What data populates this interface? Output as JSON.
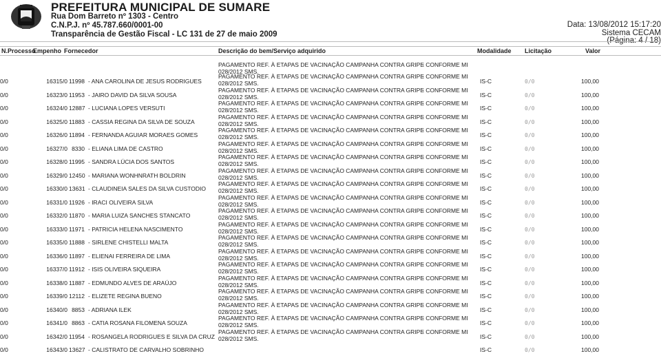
{
  "header": {
    "org_name": "PREFEITURA MUNICIPAL DE SUMARE",
    "address": "Rua Dom Barreto nº 1303 - Centro",
    "cnpj": "C.N.P.J. nº 45.787.660/0001-00",
    "subtitle": "Transparência de Gestão Fiscal - LC 131 de 27 de maio 2009",
    "date": "Data: 13/08/2012 15:17:20",
    "system": "Sistema CECAM",
    "page": "(Página: 4 / 18)",
    "logo_icon": "municipal-coat-of-arms"
  },
  "columns": {
    "processo": "N.Processo",
    "empenho": "Empenho",
    "fornecedor": "Fornecedor",
    "descricao": "Descrição do bem/Serviço adquirido",
    "modalidade": "Modalidade",
    "licitacao": "Licitação",
    "valor": "Valor"
  },
  "carryover": {
    "desc_line1": "PAGAMENTO REF. À ETAPAS DE VACINAÇÃO CAMPANHA CONTRA GRIPE",
    "desc_line2": "028/2012 SMS.",
    "conforme": "- CONFORME MI"
  },
  "rows": [
    {
      "processo": "0/0",
      "n": "16315/0",
      "empenho": "11998",
      "fornecedor": "- ANA CAROLINA DE JESUS RODRIGUES",
      "desc1": "PAGAMENTO REF. À ETAPAS DE VACINAÇÃO CAMPANHA CONTRA GRIPE",
      "desc2": "028/2012 SMS.",
      "conforme": "- CONFORME MI",
      "modalidade": "IS-C",
      "licitacao": "0/0",
      "valor": "100,00"
    },
    {
      "processo": "0/0",
      "n": "16323/0",
      "empenho": "11953",
      "fornecedor": "- JAIRO DAVID DA SILVA SOUSA",
      "desc1": "PAGAMENTO REF. À ETAPAS DE VACINAÇÃO CAMPANHA CONTRA GRIPE",
      "desc2": "028/2012 SMS.",
      "conforme": "- CONFORME MI",
      "modalidade": "IS-C",
      "licitacao": "0/0",
      "valor": "100,00"
    },
    {
      "processo": "0/0",
      "n": "16324/0",
      "empenho": "12887",
      "fornecedor": "- LUCIANA LOPES VERSUTI",
      "desc1": "PAGAMENTO REF. À ETAPAS DE VACINAÇÃO CAMPANHA CONTRA GRIPE",
      "desc2": "028/2012 SMS.",
      "conforme": "- CONFORME MI",
      "modalidade": "IS-C",
      "licitacao": "0/0",
      "valor": "100,00"
    },
    {
      "processo": "0/0",
      "n": "16325/0",
      "empenho": "11883",
      "fornecedor": "- CASSIA REGINA DA SILVA DE SOUZA",
      "desc1": "PAGAMENTO REF. À ETAPAS DE VACINAÇÃO CAMPANHA CONTRA GRIPE",
      "desc2": "028/2012 SMS.",
      "conforme": "- CONFORME MI",
      "modalidade": "IS-C",
      "licitacao": "0/0",
      "valor": "100,00"
    },
    {
      "processo": "0/0",
      "n": "16326/0",
      "empenho": "11894",
      "fornecedor": "- FERNANDA AGUIAR MORAES GOMES",
      "desc1": "PAGAMENTO REF. À ETAPAS DE VACINAÇÃO CAMPANHA CONTRA GRIPE",
      "desc2": "028/2012 SMS.",
      "conforme": "- CONFORME MI",
      "modalidade": "IS-C",
      "licitacao": "0/0",
      "valor": "100,00"
    },
    {
      "processo": "0/0",
      "n": "16327/0",
      "empenho": "8330",
      "fornecedor": "- ELIANA LIMA DE CASTRO",
      "desc1": "PAGAMENTO REF. À ETAPAS DE VACINAÇÃO CAMPANHA CONTRA GRIPE",
      "desc2": "028/2012 SMS.",
      "conforme": "- CONFORME MI",
      "modalidade": "IS-C",
      "licitacao": "0/0",
      "valor": "100,00"
    },
    {
      "processo": "0/0",
      "n": "16328/0",
      "empenho": "11995",
      "fornecedor": "- SANDRA LÚCIA DOS SANTOS",
      "desc1": "PAGAMENTO REF. À ETAPAS DE VACINAÇÃO CAMPANHA CONTRA GRIPE",
      "desc2": "028/2012 SMS.",
      "conforme": "- CONFORME MI",
      "modalidade": "IS-C",
      "licitacao": "0/0",
      "valor": "100,00"
    },
    {
      "processo": "0/0",
      "n": "16329/0",
      "empenho": "12450",
      "fornecedor": "- MARIANA WONHNRATH BOLDRIN",
      "desc1": "PAGAMENTO REF. À ETAPAS DE VACINAÇÃO CAMPANHA CONTRA GRIPE",
      "desc2": "028/2012 SMS.",
      "conforme": "- CONFORME MI",
      "modalidade": "IS-C",
      "licitacao": "0/0",
      "valor": "100,00"
    },
    {
      "processo": "0/0",
      "n": "16330/0",
      "empenho": "13631",
      "fornecedor": "- CLAUDINEIA SALES DA SILVA CUSTODIO",
      "desc1": "PAGAMENTO REF. À ETAPAS DE VACINAÇÃO CAMPANHA CONTRA GRIPE",
      "desc2": "028/2012 SMS.",
      "conforme": "- CONFORME MI",
      "modalidade": "IS-C",
      "licitacao": "0/0",
      "valor": "100,00"
    },
    {
      "processo": "0/0",
      "n": "16331/0",
      "empenho": "11926",
      "fornecedor": "- IRACI OLIVEIRA SILVA",
      "desc1": "PAGAMENTO REF. À ETAPAS DE VACINAÇÃO CAMPANHA CONTRA GRIPE",
      "desc2": "028/2012 SMS.",
      "conforme": "- CONFORME MI",
      "modalidade": "IS-C",
      "licitacao": "0/0",
      "valor": "100,00"
    },
    {
      "processo": "0/0",
      "n": "16332/0",
      "empenho": "11870",
      "fornecedor": "- MARIA LUIZA SANCHES STANCATO",
      "desc1": "PAGAMENTO REF. À ETAPAS DE VACINAÇÃO CAMPANHA CONTRA GRIPE",
      "desc2": "028/2012 SMS.",
      "conforme": "- CONFORME MI",
      "modalidade": "IS-C",
      "licitacao": "0/0",
      "valor": "100,00"
    },
    {
      "processo": "0/0",
      "n": "16333/0",
      "empenho": "11971",
      "fornecedor": "- PATRICIA HELENA NASCIMENTO",
      "desc1": "PAGAMENTO REF. À ETAPAS DE VACINAÇÃO CAMPANHA CONTRA GRIPE",
      "desc2": "028/2012 SMS.",
      "conforme": "- CONFORME MI",
      "modalidade": "IS-C",
      "licitacao": "0/0",
      "valor": "100,00"
    },
    {
      "processo": "0/0",
      "n": "16335/0",
      "empenho": "11888",
      "fornecedor": "- SIRLENE CHISTELLI MALTA",
      "desc1": "PAGAMENTO REF. À ETAPAS DE VACINAÇÃO CAMPANHA CONTRA GRIPE",
      "desc2": "028/2012 SMS.",
      "conforme": "- CONFORME MI",
      "modalidade": "IS-C",
      "licitacao": "0/0",
      "valor": "100,00"
    },
    {
      "processo": "0/0",
      "n": "16336/0",
      "empenho": "11897",
      "fornecedor": "- ELIENAI FERREIRA DE LIMA",
      "desc1": "PAGAMENTO REF. À ETAPAS DE VACINAÇÃO CAMPANHA CONTRA GRIPE",
      "desc2": "028/2012 SMS.",
      "conforme": "- CONFORME MI",
      "modalidade": "IS-C",
      "licitacao": "0/0",
      "valor": "100,00"
    },
    {
      "processo": "0/0",
      "n": "16337/0",
      "empenho": "11912",
      "fornecedor": "- ISIS OLIVEIRA SIQUEIRA",
      "desc1": "PAGAMENTO REF. À ETAPAS DE VACINAÇÃO CAMPANHA CONTRA GRIPE",
      "desc2": "028/2012 SMS.",
      "conforme": "- CONFORME MI",
      "modalidade": "IS-C",
      "licitacao": "0/0",
      "valor": "100,00"
    },
    {
      "processo": "0/0",
      "n": "16338/0",
      "empenho": "11887",
      "fornecedor": "- EDMUNDO ALVES DE ARAÚJO",
      "desc1": "PAGAMENTO REF. À ETAPAS DE VACINAÇÃO CAMPANHA CONTRA GRIPE",
      "desc2": "028/2012 SMS.",
      "conforme": "- CONFORME MI",
      "modalidade": "IS-C",
      "licitacao": "0/0",
      "valor": "100,00"
    },
    {
      "processo": "0/0",
      "n": "16339/0",
      "empenho": "12112",
      "fornecedor": "- ELIZETE REGINA BUENO",
      "desc1": "PAGAMENTO REF. À ETAPAS DE VACINAÇÃO CAMPANHA CONTRA GRIPE",
      "desc2": "028/2012 SMS.",
      "conforme": "- CONFORME MI",
      "modalidade": "IS-C",
      "licitacao": "0/0",
      "valor": "100,00"
    },
    {
      "processo": "0/0",
      "n": "16340/0",
      "empenho": "8853",
      "fornecedor": "- ADRIANA ILEK",
      "desc1": "PAGAMENTO REF. À ETAPAS DE VACINAÇÃO CAMPANHA CONTRA GRIPE",
      "desc2": "028/2012 SMS.",
      "conforme": "- CONFORME MI",
      "modalidade": "IS-C",
      "licitacao": "0/0",
      "valor": "100,00"
    },
    {
      "processo": "0/0",
      "n": "16341/0",
      "empenho": "8863",
      "fornecedor": "- CATIA ROSANA FILOMENA SOUZA",
      "desc1": "PAGAMENTO REF. À ETAPAS DE VACINAÇÃO CAMPANHA CONTRA GRIPE",
      "desc2": "028/2012 SMS.",
      "conforme": "- CONFORME MI",
      "modalidade": "IS-C",
      "licitacao": "0/0",
      "valor": "100,00"
    },
    {
      "processo": "0/0",
      "n": "16342/0",
      "empenho": "11954",
      "fornecedor": "- ROSANGELA RODRIGUES E SILVA DA CRUZ",
      "desc1": "PAGAMENTO REF. À ETAPAS DE VACINAÇÃO CAMPANHA CONTRA GRIPE",
      "desc2": "028/2012 SMS.",
      "conforme": "- CONFORME MI",
      "modalidade": "IS-C",
      "licitacao": "0/0",
      "valor": "100,00"
    },
    {
      "processo": "0/0",
      "n": "16343/0",
      "empenho": "13627",
      "fornecedor": "- CALISTRATO DE CARVALHO SOBRINHO",
      "desc1": "",
      "desc2": "",
      "conforme": "",
      "modalidade": "IS-C",
      "licitacao": "0/0",
      "valor": "100,00"
    }
  ]
}
